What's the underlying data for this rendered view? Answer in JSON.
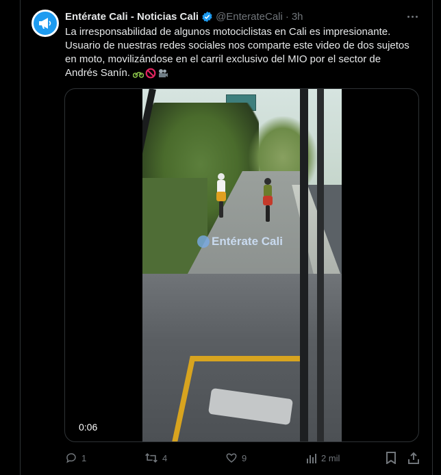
{
  "tweet": {
    "display_name": "Entérate Cali - Noticias Cali",
    "handle": "@EnterateCali",
    "separator": "·",
    "time": "3h",
    "text_line1": "La irresponsabilidad de algunos motociclistas en Cali es impresionante.",
    "text_line2": "Usuario de nuestras redes sociales nos comparte este video de dos sujetos",
    "text_line3": "en moto, movilizándose en el carril exclusivo del MIO por el sector de",
    "text_line4": "Andrés Sanín.",
    "emoji_names": [
      "motorcycle-emoji",
      "prohibited-emoji",
      "movie-camera-emoji"
    ]
  },
  "media": {
    "duration": "0:06",
    "watermark": "Entérate Cali"
  },
  "actions": {
    "replies": "1",
    "retweets": "4",
    "likes": "9",
    "views": "2 mil"
  },
  "colors": {
    "accent": "#1d9bf0",
    "text": "#e7e9ea",
    "muted": "#71767b",
    "border": "#2f3336"
  }
}
